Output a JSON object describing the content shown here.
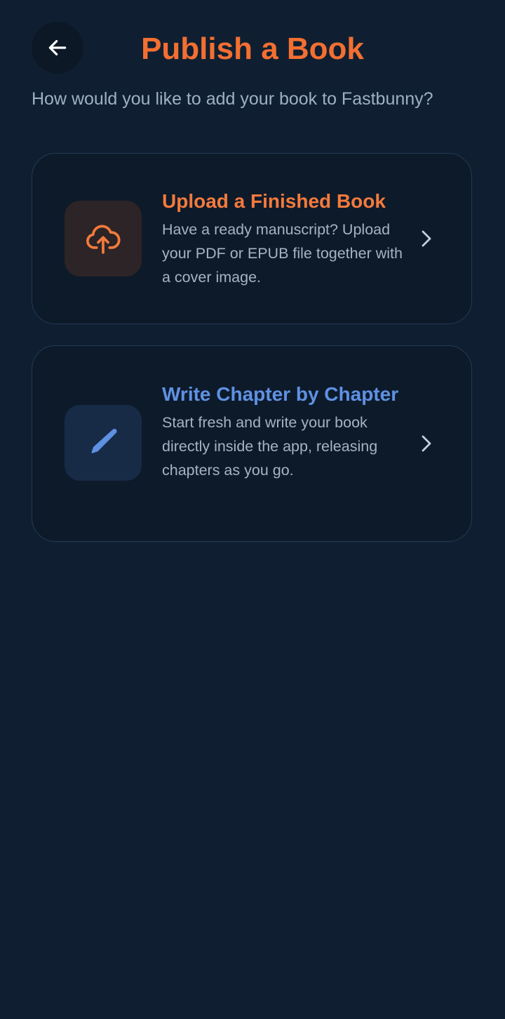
{
  "header": {
    "title": "Publish a Book",
    "back_icon": "arrow-left-icon"
  },
  "subtitle": "How would you like to add your book to Fastbunny?",
  "options": [
    {
      "title": "Upload a Finished Book",
      "description": "Have a ready manuscript? Upload your PDF or EPUB file together with a cover image.",
      "icon": "cloud-upload-icon",
      "accent": "#f47a3c"
    },
    {
      "title": "Write Chapter by Chapter",
      "description": "Start fresh and write your book directly inside the app, releasing chapters as you go.",
      "icon": "pencil-icon",
      "accent": "#5f91e3"
    }
  ],
  "colors": {
    "background": "#0f1f31",
    "title": "#f36f31"
  }
}
